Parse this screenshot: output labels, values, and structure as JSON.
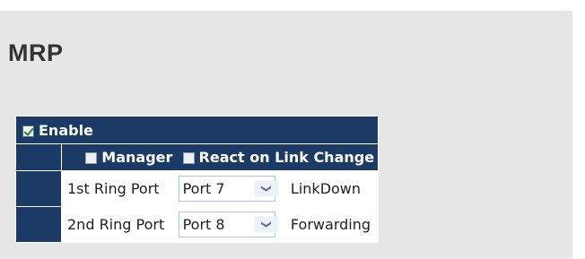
{
  "page": {
    "title": "MRP"
  },
  "enable": {
    "label": "Enable",
    "checked": true
  },
  "options": [
    {
      "label": "Manager",
      "checked": false
    },
    {
      "label": "React on Link Change",
      "checked": false
    }
  ],
  "ports": [
    {
      "label": "1st Ring Port",
      "selected": "Port 7",
      "status": "LinkDown"
    },
    {
      "label": "2nd Ring Port",
      "selected": "Port 8",
      "status": "Forwarding"
    }
  ],
  "icons": {
    "dropdown": "chevron-down-icon",
    "checkbox": "checkbox-icon"
  },
  "colors": {
    "header_bg": "#1b3a66",
    "panel_bg": "#e6e6e6",
    "checkmark": "#1c8a23"
  }
}
